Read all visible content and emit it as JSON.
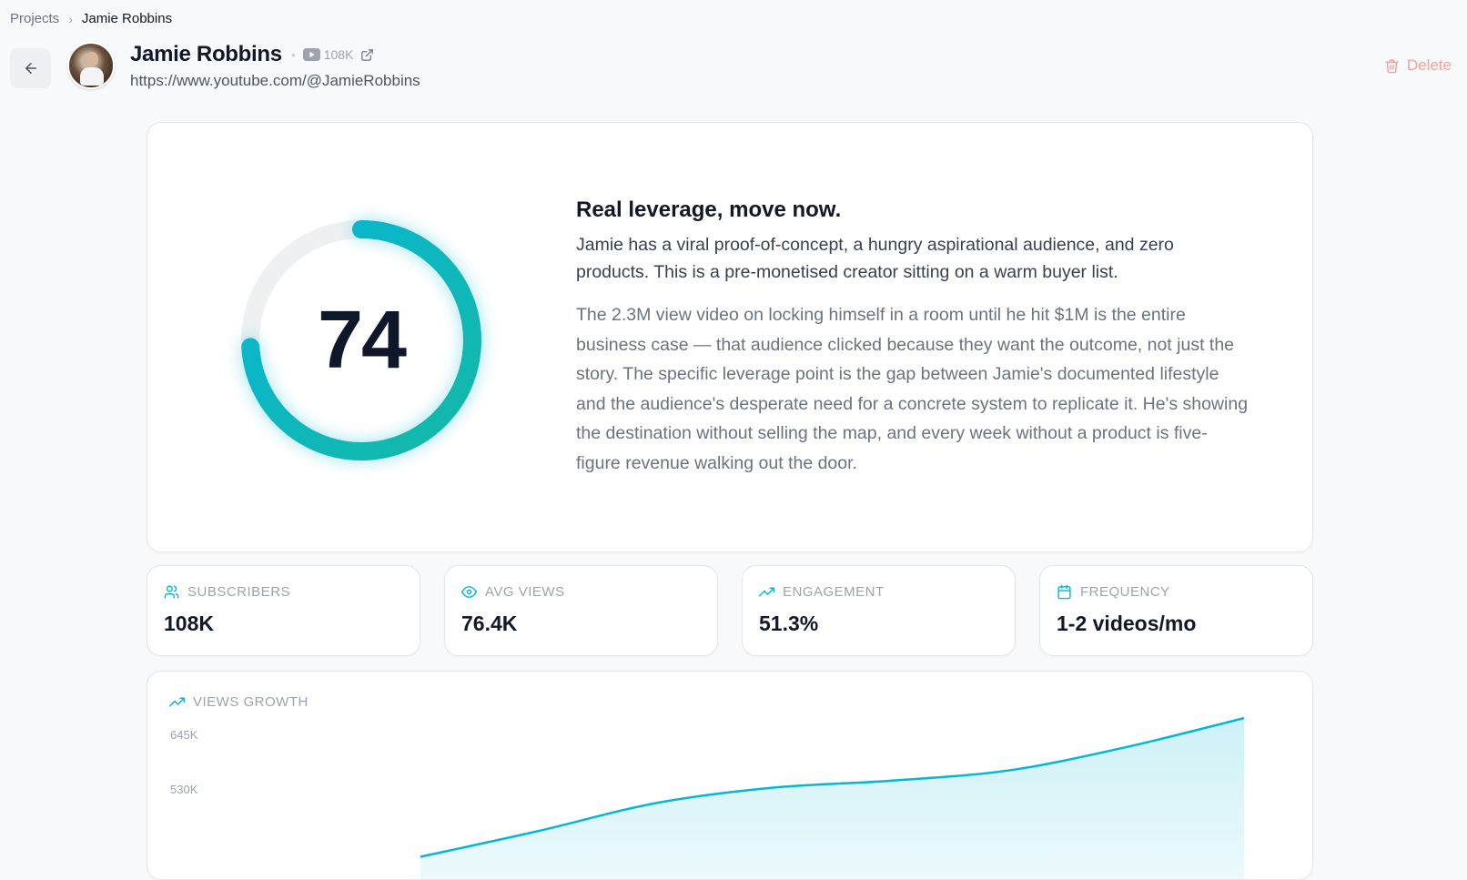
{
  "breadcrumb": {
    "parent": "Projects",
    "separator": "›",
    "current": "Jamie Robbins"
  },
  "channel": {
    "name": "Jamie Robbins",
    "platform_icon": "youtube-icon",
    "subscriber_badge": "108K",
    "url": "https://www.youtube.com/@JamieRobbins"
  },
  "actions": {
    "delete_label": "Delete"
  },
  "score": {
    "value": "74",
    "fraction": 0.74,
    "colors": {
      "track": "#eef0f2",
      "start": "#14b8a6",
      "end": "#06b6d4"
    }
  },
  "verdict": {
    "title": "Real leverage, move now.",
    "summary": "Jamie has a viral proof-of-concept, a hungry aspirational audience, and zero products. This is a pre-monetised creator sitting on a warm buyer list.",
    "body": "The 2.3M view video on locking himself in a room until he hit $1M is the entire business case — that audience clicked because they want the outcome, not just the story. The specific leverage point is the gap between Jamie's documented lifestyle and the audience's desperate need for a concrete system to replicate it. He's showing the destination without selling the map, and every week without a product is five-figure revenue walking out the door."
  },
  "stats": [
    {
      "icon": "users-icon",
      "label": "SUBSCRIBERS",
      "value": "108K"
    },
    {
      "icon": "eye-icon",
      "label": "AVG VIEWS",
      "value": "76.4K"
    },
    {
      "icon": "trending-up-icon",
      "label": "ENGAGEMENT",
      "value": "51.3%"
    },
    {
      "icon": "calendar-icon",
      "label": "FREQUENCY",
      "value": "1-2 videos/mo"
    }
  ],
  "growth": {
    "label": "VIEWS GROWTH",
    "accent": "#06b6d4"
  },
  "chart_data": {
    "type": "area",
    "title": "VIEWS GROWTH",
    "yticks": [
      "645K",
      "530K"
    ],
    "ylim": [
      300000,
      645000
    ],
    "x": [
      1,
      2,
      3,
      4,
      5,
      6,
      7,
      8
    ],
    "values": [
      340000,
      395000,
      455000,
      488000,
      503000,
      525000,
      575000,
      637000
    ],
    "xlabel": "",
    "ylabel": "",
    "grid": false
  }
}
